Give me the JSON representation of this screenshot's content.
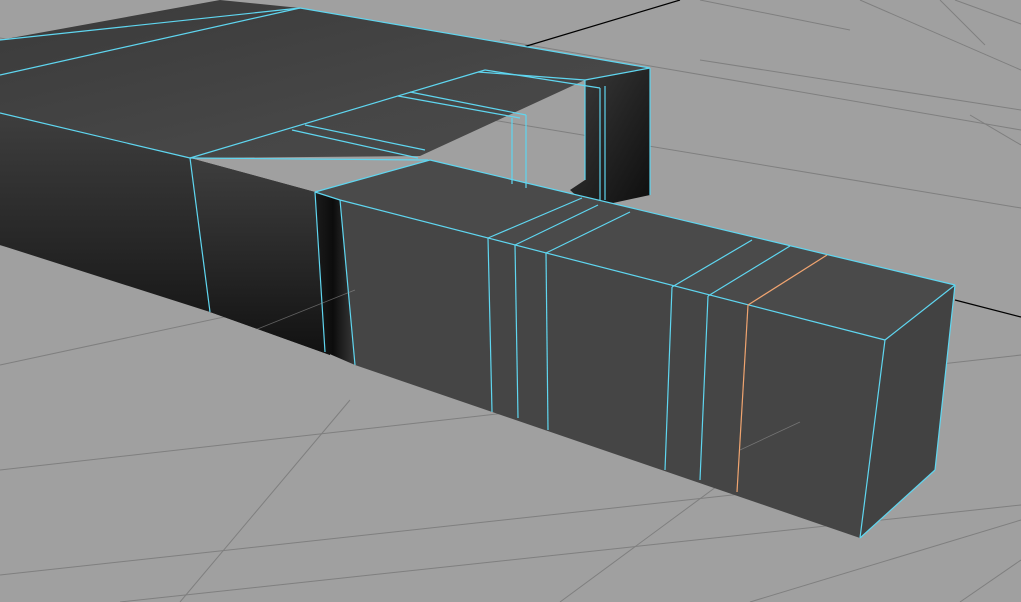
{
  "viewport": {
    "view": "perspective",
    "background_color": "#a0a0a0",
    "grid_visible": true,
    "grid_line_color": "#7e7e7e",
    "grid_axis_color": "#000000"
  },
  "scene": {
    "object_type": "polygon mesh",
    "face_color": "#484848",
    "shadow_color": "#141414",
    "wireframe_color": "#5fd6f0",
    "selected_edge_color": "#f0a470",
    "selection_mode": "edge",
    "selected_edge_loops": 1
  }
}
